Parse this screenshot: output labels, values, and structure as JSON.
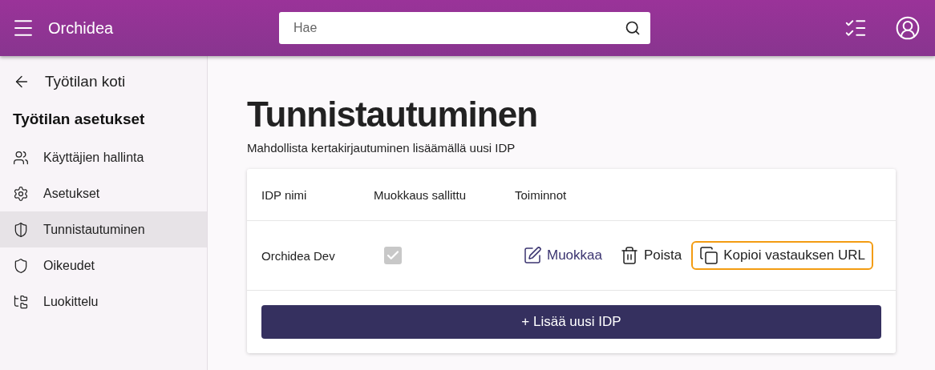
{
  "header": {
    "app_name": "Orchidea",
    "search": {
      "placeholder": "Hae"
    }
  },
  "sidebar": {
    "back": {
      "label": "Työtilan koti"
    },
    "heading": "Työtilan asetukset",
    "items": [
      {
        "label": "Käyttäjien hallinta",
        "selected": false
      },
      {
        "label": "Asetukset",
        "selected": false
      },
      {
        "label": "Tunnistautuminen",
        "selected": true
      },
      {
        "label": "Oikeudet",
        "selected": false
      },
      {
        "label": "Luokittelu",
        "selected": false
      }
    ]
  },
  "page": {
    "title": "Tunnistautuminen",
    "subtitle": "Mahdollista kertakirjautuminen lisäämällä uusi IDP"
  },
  "table": {
    "columns": [
      "IDP nimi",
      "Muokkaus sallittu",
      "Toiminnot"
    ],
    "rows": [
      {
        "name": "Orchidea Dev",
        "editable": {
          "checked": true,
          "disabled": true
        },
        "actions": [
          {
            "kind": "edit",
            "label": "Muokkaa",
            "focused": false
          },
          {
            "kind": "delete",
            "label": "Poista",
            "focused": false
          },
          {
            "kind": "copy",
            "label": "Kopioi vastauksen URL",
            "focused": true
          }
        ]
      }
    ]
  },
  "add_button": {
    "label": "+ Lisää uusi IDP"
  }
}
